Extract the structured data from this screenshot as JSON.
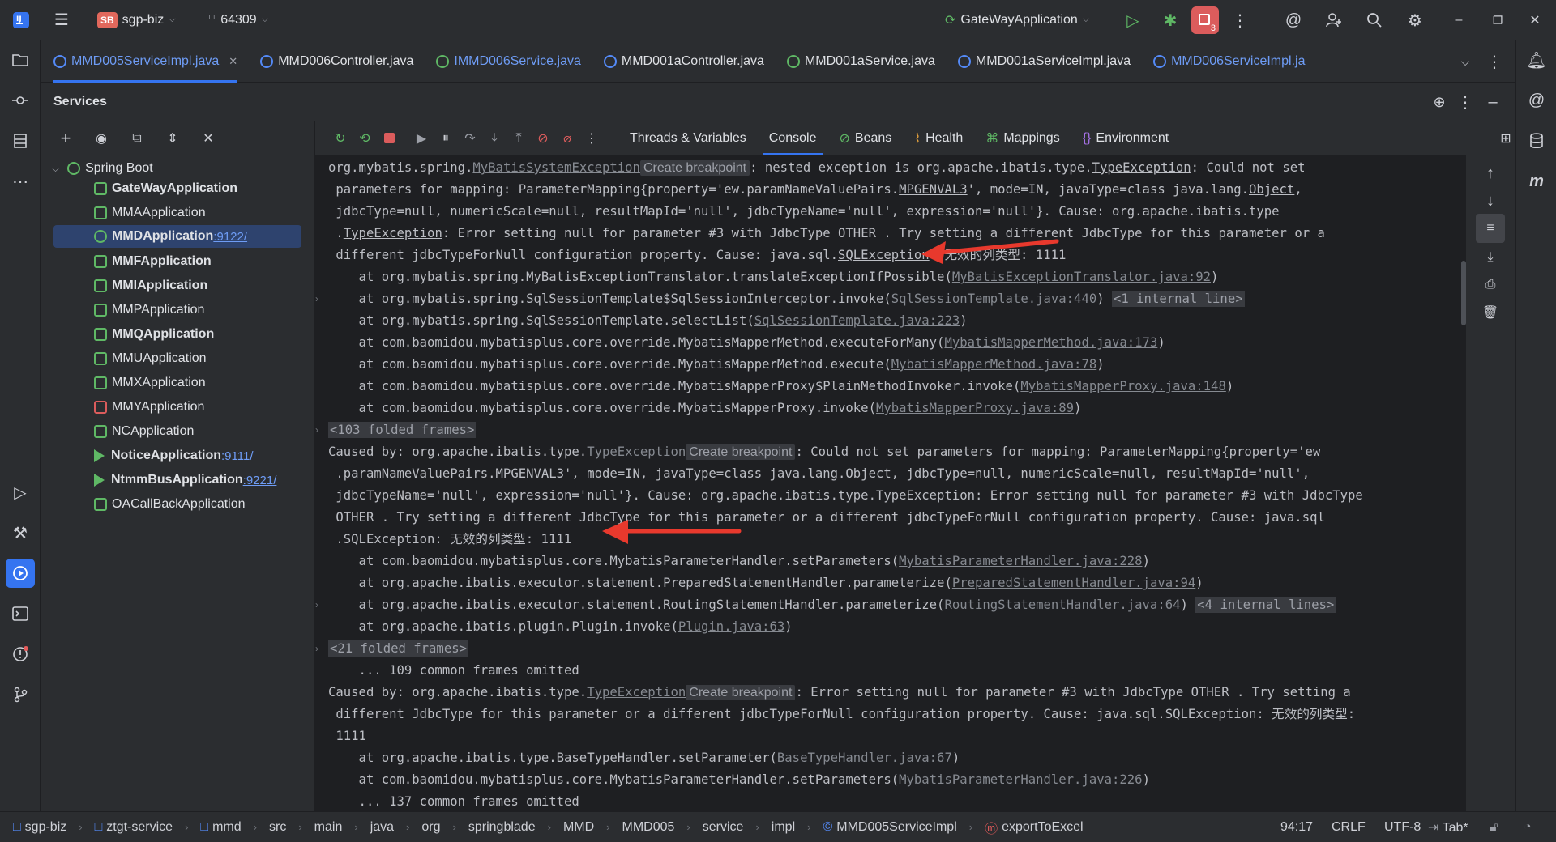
{
  "titlebar": {
    "project_badge": "SB",
    "project_name": "sgp-biz",
    "branch": "64309",
    "run_config": "GateWayApplication",
    "problems_count": "3"
  },
  "tabs": [
    {
      "label": "MMD005ServiceImpl.java",
      "kind": "class",
      "active": true
    },
    {
      "label": "MMD006Controller.java",
      "kind": "class"
    },
    {
      "label": "IMMD006Service.java",
      "kind": "interface"
    },
    {
      "label": "MMD001aController.java",
      "kind": "class"
    },
    {
      "label": "MMD001aService.java",
      "kind": "interface"
    },
    {
      "label": "MMD001aServiceImpl.java",
      "kind": "class"
    },
    {
      "label": "MMD006ServiceImpl.ja",
      "kind": "class"
    }
  ],
  "services": {
    "title": "Services",
    "group": "Spring Boot",
    "apps": [
      {
        "name": "GateWayApplication",
        "port": "",
        "bold": true
      },
      {
        "name": "MMAApplication",
        "port": "",
        "bold": false
      },
      {
        "name": "MMDApplication",
        "port": " :9122/",
        "bold": true
      },
      {
        "name": "MMFApplication",
        "port": "",
        "bold": true
      },
      {
        "name": "MMIApplication",
        "port": "",
        "bold": true
      },
      {
        "name": "MMPApplication",
        "port": "",
        "bold": false
      },
      {
        "name": "MMQApplication",
        "port": "",
        "bold": true
      },
      {
        "name": "MMUApplication",
        "port": "",
        "bold": false
      },
      {
        "name": "MMXApplication",
        "port": "",
        "bold": false
      },
      {
        "name": "MMYApplication",
        "port": "",
        "bold": false
      },
      {
        "name": "NCApplication",
        "port": "",
        "bold": false
      },
      {
        "name": "NoticeApplication",
        "port": " :9111/",
        "bold": true
      },
      {
        "name": "NtmmBusApplication",
        "port": " :9221/",
        "bold": true
      },
      {
        "name": "OACallBackApplication",
        "port": "",
        "bold": false
      }
    ]
  },
  "console_tabs": {
    "threads": "Threads & Variables",
    "console": "Console",
    "beans": "Beans",
    "health": "Health",
    "mappings": "Mappings",
    "environment": "Environment"
  },
  "console": {
    "create_breakpoint": "Create breakpoint",
    "l0a": "org.mybatis.spring.",
    "l0b": "MyBatisSystemException",
    "l0c": ": nested exception is org.apache.ibatis.type.",
    "l0d": "TypeException",
    "l0e": ": Could not set",
    "l1a": " parameters for mapping: ParameterMapping{property='ew.paramNameValuePairs.",
    "l1b": "MPGENVAL3",
    "l1c": "', mode=IN, javaType=class java.lang.",
    "l1d": "Object",
    "l1e": ",",
    "l2": " jdbcType=null, numericScale=null, resultMapId='null', jdbcTypeName='null', expression='null'}. Cause: org.apache.ibatis.type",
    "l3a": " .",
    "l3b": "TypeException",
    "l3c": ": Error setting null for parameter #3 with JdbcType OTHER . Try setting a different JdbcType for this parameter or a",
    "l4a": " different jdbcTypeForNull configuration property. Cause: java.sql.",
    "l4b": "SQLException",
    "l4c": ": 无效的列类型: 1111",
    "l5a": "    at org.mybatis.spring.MyBatisExceptionTranslator.translateExceptionIfPossible(",
    "l5b": "MyBatisExceptionTranslator.java:92",
    "l5c": ")",
    "l6a": "    at org.mybatis.spring.SqlSessionTemplate$SqlSessionInterceptor.invoke(",
    "l6b": "SqlSessionTemplate.java:440",
    "l6c": ") ",
    "l6d": "<1 internal line>",
    "l7a": "    at org.mybatis.spring.SqlSessionTemplate.selectList(",
    "l7b": "SqlSessionTemplate.java:223",
    "l7c": ")",
    "l8a": "    at com.baomidou.mybatisplus.core.override.MybatisMapperMethod.executeForMany(",
    "l8b": "MybatisMapperMethod.java:173",
    "l8c": ")",
    "l9a": "    at com.baomidou.mybatisplus.core.override.MybatisMapperMethod.execute(",
    "l9b": "MybatisMapperMethod.java:78",
    "l9c": ")",
    "l10a": "    at com.baomidou.mybatisplus.core.override.MybatisMapperProxy$PlainMethodInvoker.invoke(",
    "l10b": "MybatisMapperProxy.java:148",
    "l10c": ")",
    "l11a": "    at com.baomidou.mybatisplus.core.override.MybatisMapperProxy.invoke(",
    "l11b": "MybatisMapperProxy.java:89",
    "l11c": ")",
    "l12": "<103 folded frames>",
    "l13a": "Caused by: org.apache.ibatis.type.",
    "l13b": "TypeException",
    "l13c": ": Could not set parameters for mapping: ParameterMapping{property='ew",
    "l14": " .paramNameValuePairs.MPGENVAL3', mode=IN, javaType=class java.lang.Object, jdbcType=null, numericScale=null, resultMapId='null',",
    "l15": " jdbcTypeName='null', expression='null'}. Cause: org.apache.ibatis.type.TypeException: Error setting null for parameter #3 with JdbcType",
    "l16": " OTHER . Try setting a different JdbcType for this parameter or a different jdbcTypeForNull configuration property. Cause: java.sql",
    "l17": " .SQLException: 无效的列类型: 1111",
    "l18a": "    at com.baomidou.mybatisplus.core.MybatisParameterHandler.setParameters(",
    "l18b": "MybatisParameterHandler.java:228",
    "l18c": ")",
    "l19a": "    at org.apache.ibatis.executor.statement.PreparedStatementHandler.parameterize(",
    "l19b": "PreparedStatementHandler.java:94",
    "l19c": ")",
    "l20a": "    at org.apache.ibatis.executor.statement.RoutingStatementHandler.parameterize(",
    "l20b": "RoutingStatementHandler.java:64",
    "l20c": ") ",
    "l20d": "<4 internal lines>",
    "l21a": "    at org.apache.ibatis.plugin.Plugin.invoke(",
    "l21b": "Plugin.java:63",
    "l21c": ")",
    "l22": "<21 folded frames>",
    "l23": "    ... 109 common frames omitted",
    "l24a": "Caused by: org.apache.ibatis.type.",
    "l24b": "TypeException",
    "l24c": ": Error setting null for parameter #3 with JdbcType OTHER . Try setting a",
    "l25": " different JdbcType for this parameter or a different jdbcTypeForNull configuration property. Cause: java.sql.SQLException: 无效的列类型:",
    "l26": " 1111",
    "l27a": "    at org.apache.ibatis.type.BaseTypeHandler.setParameter(",
    "l27b": "BaseTypeHandler.java:67",
    "l27c": ")",
    "l28a": "    at com.baomidou.mybatisplus.core.MybatisParameterHandler.setParameters(",
    "l28b": "MybatisParameterHandler.java:226",
    "l28c": ")",
    "l29": "    ... 137 common frames omitted"
  },
  "statusbar": {
    "crumbs": [
      "sgp-biz",
      "ztgt-service",
      "mmd",
      "src",
      "main",
      "java",
      "org",
      "springblade",
      "MMD",
      "MMD005",
      "service",
      "impl",
      "MMD005ServiceImpl",
      "exportToExcel"
    ],
    "position": "94:17",
    "line_sep": "CRLF",
    "encoding": "UTF-8",
    "indent": "Tab*"
  },
  "colors": {
    "accent": "#3574f0",
    "annotation_arrow": "#e8392d",
    "running": "#5fb865"
  }
}
